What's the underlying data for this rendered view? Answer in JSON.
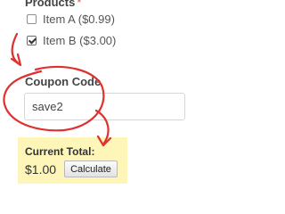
{
  "products": {
    "label": "Products",
    "required_marker": "*",
    "items": [
      {
        "label": "Item A ($0.99)",
        "checked": false
      },
      {
        "label": "Item B ($3.00)",
        "checked": true
      }
    ]
  },
  "coupon": {
    "label": "Coupon Code",
    "value": "save2"
  },
  "total": {
    "label": "Current Total:",
    "value": "$1.00",
    "calculate_label": "Calculate"
  },
  "annotation": {
    "color": "#e03030"
  },
  "colors": {
    "highlight": "#fdf6b8"
  }
}
